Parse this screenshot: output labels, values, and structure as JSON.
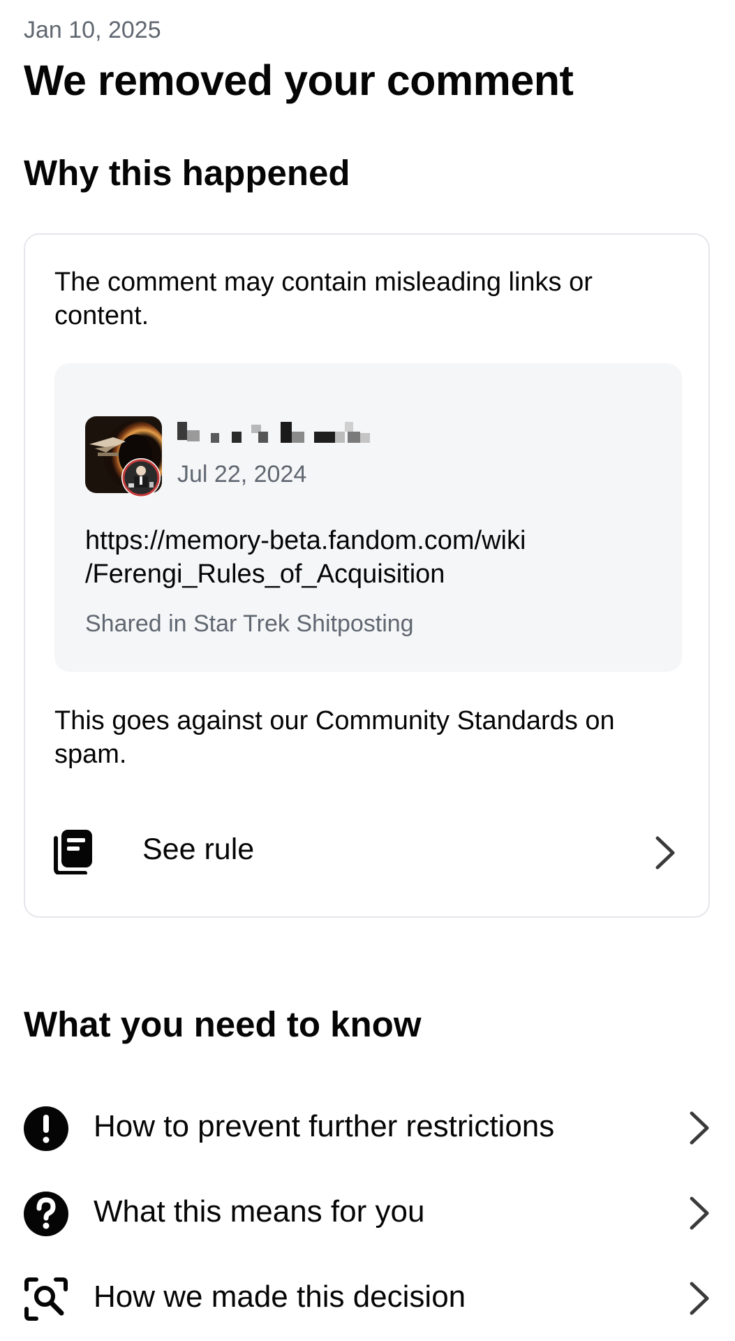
{
  "header": {
    "date": "Jan 10, 2025",
    "title": "We removed your comment"
  },
  "why": {
    "heading": "Why this happened",
    "reason": "The comment may contain misleading links or content.",
    "post": {
      "author": "",
      "date": "Jul 22, 2024",
      "link": "https://memory-beta.fandom.com/wiki\n/Ferengi_Rules_of_Acquisition",
      "shared_in": "Shared in Star Trek Shitposting"
    },
    "standards": "This goes against our Community Standards on spam.",
    "see_rule_label": "See rule"
  },
  "know": {
    "heading": "What you need to know",
    "items": [
      {
        "label": "How to prevent further restrictions",
        "icon": "exclamation-circle-icon"
      },
      {
        "label": "What this means for you",
        "icon": "question-circle-icon"
      },
      {
        "label": "How we made this decision",
        "icon": "magnify-scan-icon"
      }
    ]
  },
  "colors": {
    "text_primary": "#050505",
    "text_secondary": "#606770",
    "card_border": "#e4e6eb",
    "preview_bg": "#f5f6f8"
  }
}
